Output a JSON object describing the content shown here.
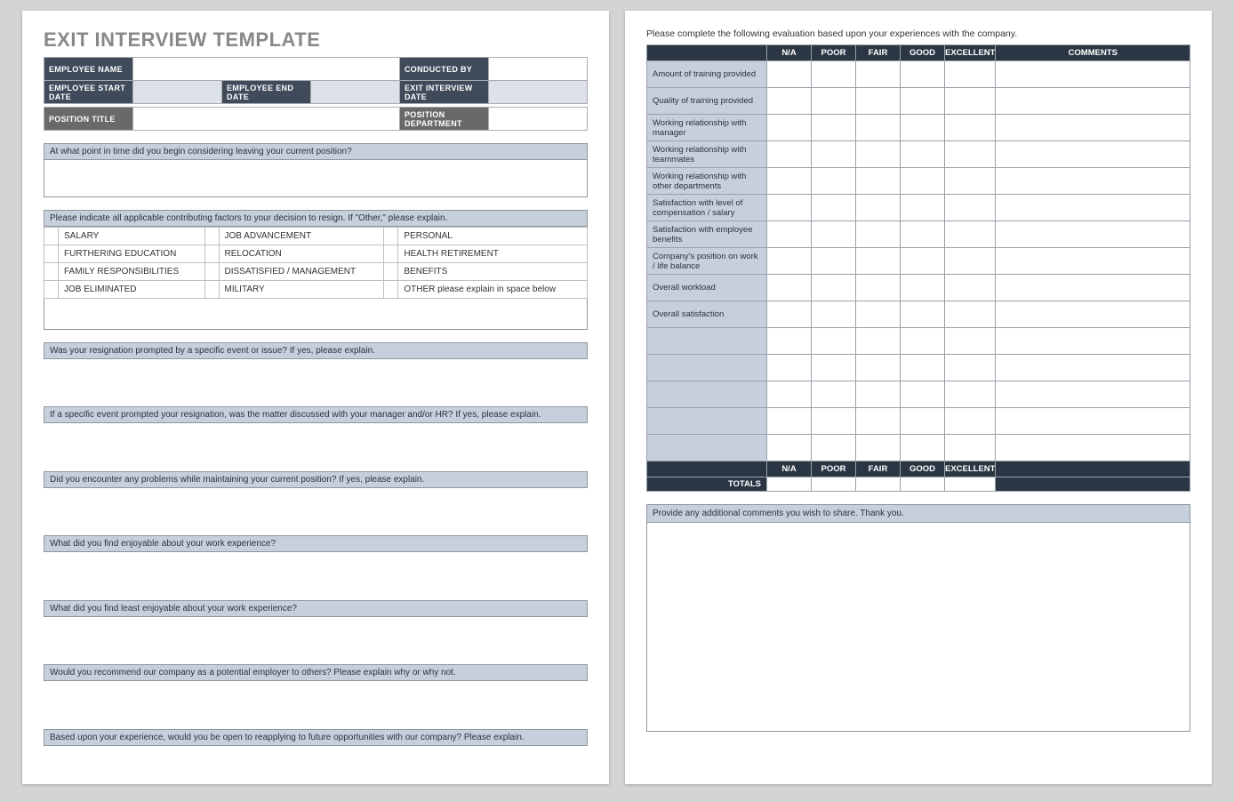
{
  "title": "EXIT INTERVIEW TEMPLATE",
  "header": {
    "employee_name": "EMPLOYEE NAME",
    "conducted_by": "CONDUCTED BY",
    "start_date": "EMPLOYEE START DATE",
    "end_date": "EMPLOYEE END DATE",
    "interview_date": "EXIT INTERVIEW DATE",
    "position_title": "POSITION TITLE",
    "position_dept": "POSITION DEPARTMENT"
  },
  "questions": {
    "q1": "At what point in time did you begin considering leaving your current position?",
    "q2_head": "Please indicate all applicable contributing factors to your decision to resign. If \"Other,\" please explain.",
    "factors": {
      "r1c1": "SALARY",
      "r1c2": "JOB ADVANCEMENT",
      "r1c3": "PERSONAL",
      "r2c1": "FURTHERING EDUCATION",
      "r2c2": "RELOCATION",
      "r2c3": "HEALTH RETIREMENT",
      "r3c1": "FAMILY RESPONSIBILITIES",
      "r3c2": "DISSATISFIED / MANAGEMENT",
      "r3c3": "BENEFITS",
      "r4c1": "JOB ELIMINATED",
      "r4c2": "MILITARY",
      "r4c3": "OTHER please explain in space below"
    },
    "q3": "Was your resignation prompted by a specific event or issue? If yes, please explain.",
    "q4": "If a specific event prompted your resignation, was the matter discussed with your manager and/or HR? If yes, please explain.",
    "q5": "Did you encounter any problems while maintaining your current position?  If yes, please explain.",
    "q6": "What did you find enjoyable about your work experience?",
    "q7": "What did you find least enjoyable about your work experience?",
    "q8": "Would you recommend our company as a potential employer to others? Please explain why or why not.",
    "q9": "Based upon your experience, would you be open to reapplying to future opportunities with our company?  Please explain."
  },
  "page2": {
    "intro": "Please complete the following evaluation based upon your experiences with the company.",
    "cols": {
      "na": "N/A",
      "poor": "POOR",
      "fair": "FAIR",
      "good": "GOOD",
      "exc": "EXCELLENT",
      "comments": "COMMENTS"
    },
    "rows": [
      "Amount of training provided",
      "Quality of training provided",
      "Working relationship with manager",
      "Working relationship with teammates",
      "Working relationship with other departments",
      "Satisfaction with level of compensation / salary",
      "Satisfaction with employee benefits",
      "Company's position on work / life balance",
      "Overall workload",
      "Overall satisfaction"
    ],
    "totals": "TOTALS",
    "final": "Provide any additional comments you wish to share.  Thank you."
  }
}
